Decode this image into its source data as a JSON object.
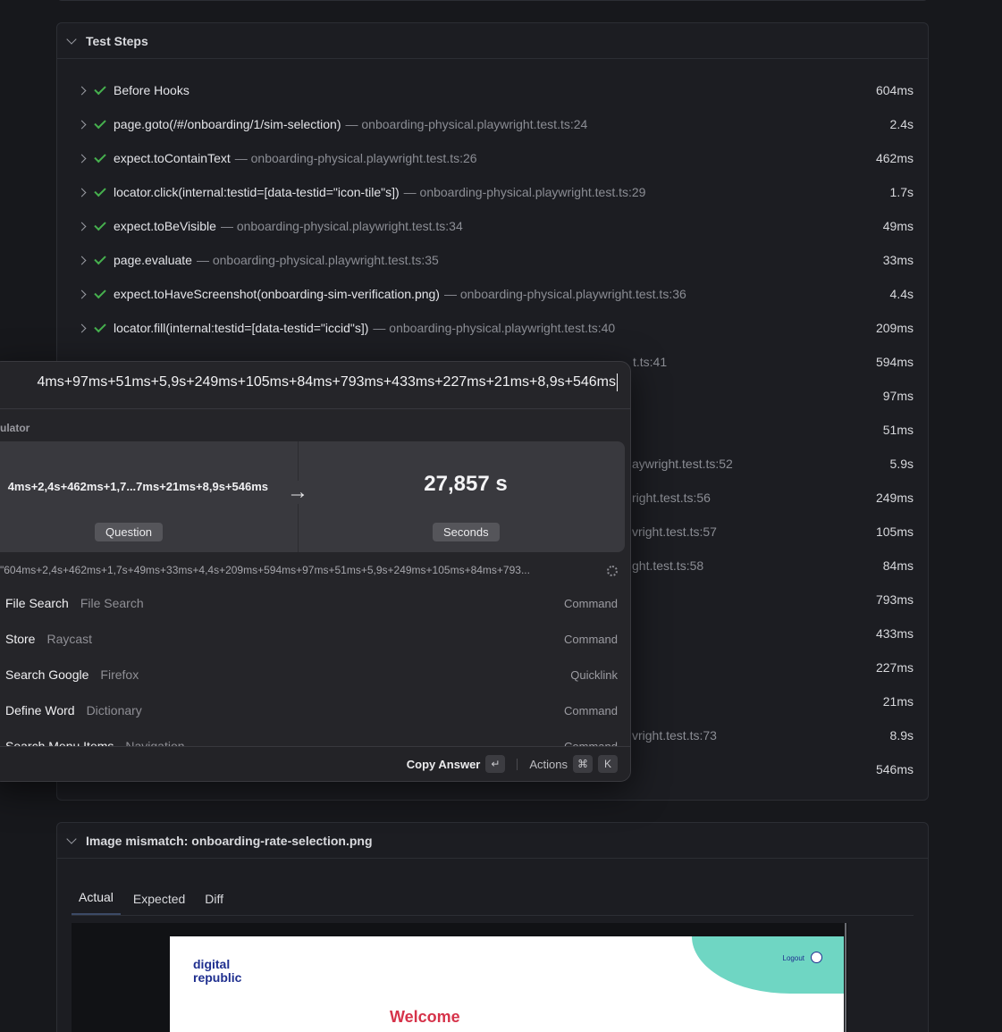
{
  "test_steps": {
    "title": "Test Steps",
    "steps": [
      {
        "title": "Before Hooks",
        "location": "",
        "duration": "604ms"
      },
      {
        "title": "page.goto(/#/onboarding/1/sim-selection)",
        "location": "— onboarding-physical.playwright.test.ts:24",
        "duration": "2.4s"
      },
      {
        "title": "expect.toContainText",
        "location": "— onboarding-physical.playwright.test.ts:26",
        "duration": "462ms"
      },
      {
        "title": "locator.click(internal:testid=[data-testid=\"icon-tile\"s])",
        "location": "— onboarding-physical.playwright.test.ts:29",
        "duration": "1.7s"
      },
      {
        "title": "expect.toBeVisible",
        "location": "— onboarding-physical.playwright.test.ts:34",
        "duration": "49ms"
      },
      {
        "title": "page.evaluate",
        "location": "— onboarding-physical.playwright.test.ts:35",
        "duration": "33ms"
      },
      {
        "title": "expect.toHaveScreenshot(onboarding-sim-verification.png)",
        "location": "— onboarding-physical.playwright.test.ts:36",
        "duration": "4.4s"
      },
      {
        "title": "locator.fill(internal:testid=[data-testid=\"iccid\"s])",
        "location": "— onboarding-physical.playwright.test.ts:40",
        "duration": "209ms"
      }
    ],
    "partial_rows": [
      {
        "location": "t.ts:41",
        "duration": "594ms"
      },
      {
        "location": "",
        "duration": "97ms"
      },
      {
        "location": "",
        "duration": "51ms"
      },
      {
        "location": "aywright.test.ts:52",
        "duration": "5.9s"
      },
      {
        "location": "right.test.ts:56",
        "duration": "249ms"
      },
      {
        "location": "vright.test.ts:57",
        "duration": "105ms"
      },
      {
        "location": "ght.test.ts:58",
        "duration": "84ms"
      },
      {
        "location": "",
        "duration": "793ms"
      },
      {
        "location": "",
        "duration": "433ms"
      },
      {
        "location": "",
        "duration": "227ms"
      },
      {
        "location": "",
        "duration": "21ms"
      },
      {
        "location": "vright.test.ts:73",
        "duration": "8.9s"
      },
      {
        "location": "",
        "duration": "546ms"
      }
    ]
  },
  "image_mismatch": {
    "title": "Image mismatch: onboarding-rate-selection.png",
    "tabs": [
      "Actual",
      "Expected",
      "Diff"
    ],
    "active_tab": "Actual",
    "preview": {
      "brand_line1": "digital",
      "brand_line2": "republic",
      "logout": "Logout",
      "welcome": "Welcome"
    }
  },
  "raycast": {
    "query": "4ms+97ms+51ms+5,9s+249ms+105ms+84ms+793ms+433ms+227ms+21ms+8,9s+546ms",
    "section": "ulator",
    "calc": {
      "question": "4ms+2,4s+462ms+1,7...7ms+21ms+8,9s+546ms",
      "arrow": "→",
      "answer": "27,857 s",
      "question_tag": "Question",
      "answer_tag": "Seconds"
    },
    "expression": "\"604ms+2,4s+462ms+1,7s+49ms+33ms+4,4s+209ms+594ms+97ms+51ms+5,9s+249ms+105ms+84ms+793...",
    "items": [
      {
        "title": "File Search",
        "subtitle": "File Search",
        "kind": "Command"
      },
      {
        "title": "Store",
        "subtitle": "Raycast",
        "kind": "Command"
      },
      {
        "title": "Search Google",
        "subtitle": "Firefox",
        "kind": "Quicklink"
      },
      {
        "title": "Define Word",
        "subtitle": "Dictionary",
        "kind": "Command"
      },
      {
        "title": "Search Menu Items",
        "subtitle": "Navigation",
        "kind": "Command"
      }
    ],
    "footer": {
      "primary": "Copy Answer",
      "primary_key": "↵",
      "secondary": "Actions",
      "key1": "⌘",
      "key2": "K"
    }
  }
}
